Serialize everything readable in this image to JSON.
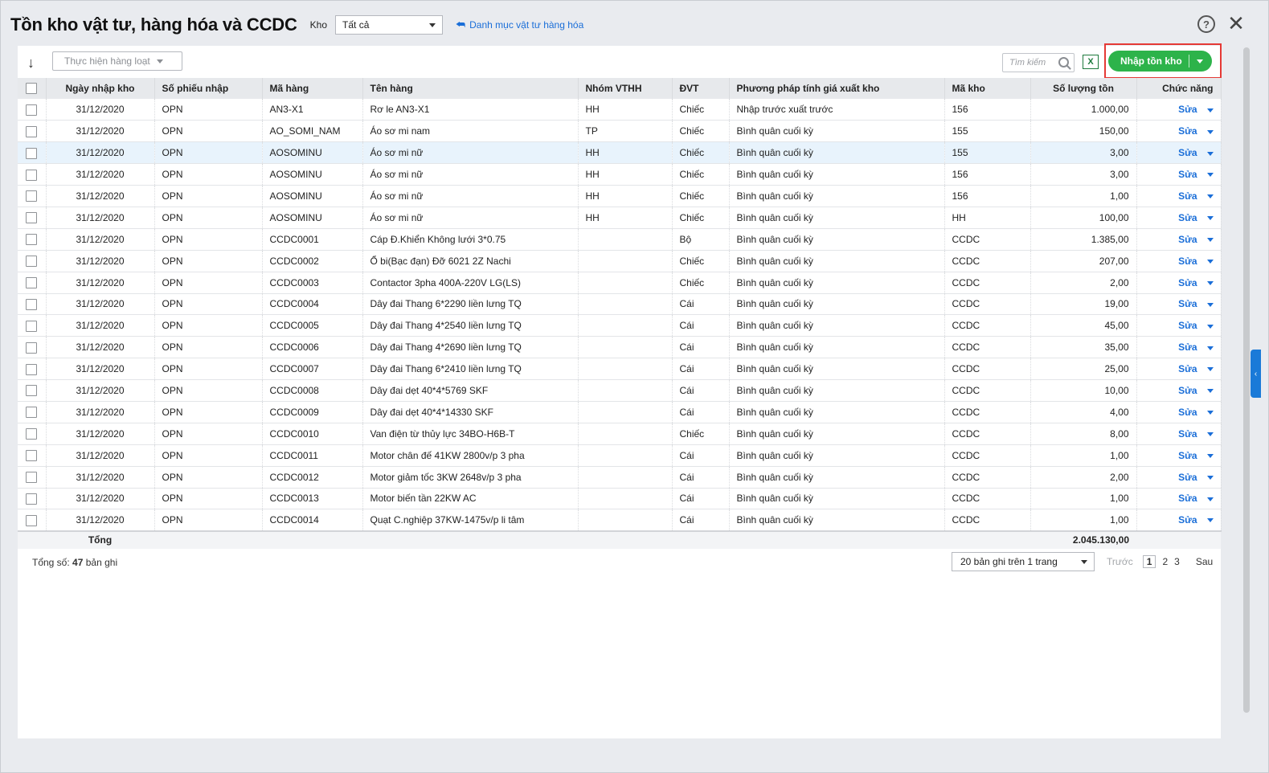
{
  "header": {
    "title": "Tồn kho vật tư, hàng hóa và CCDC",
    "kho_label": "Kho",
    "kho_value": "Tất cả",
    "catalog_link": "Danh mục vật tư hàng hóa",
    "help": "?",
    "close": "✕"
  },
  "toolbar": {
    "bulk_action": "Thực hiện hàng loạt",
    "search_placeholder": "Tìm kiếm",
    "excel": "X",
    "import_button": "Nhập tồn kho"
  },
  "columns": [
    "Ngày nhập kho",
    "Số phiếu nhập",
    "Mã hàng",
    "Tên hàng",
    "Nhóm VTHH",
    "ĐVT",
    "Phương pháp tính giá xuất kho",
    "Mã kho",
    "Số lượng tồn",
    "Chức năng"
  ],
  "rows": [
    {
      "date": "31/12/2020",
      "doc": "OPN",
      "code": "AN3-X1",
      "name": "Rơ le AN3-X1",
      "group": "HH",
      "unit": "Chiếc",
      "method": "Nhập trước xuất trước",
      "wh": "156",
      "qty": "1.000,00",
      "action": "Sửa"
    },
    {
      "date": "31/12/2020",
      "doc": "OPN",
      "code": "AO_SOMI_NAM",
      "name": "Áo sơ mi nam",
      "group": "TP",
      "unit": "Chiếc",
      "method": "Bình quân cuối kỳ",
      "wh": "155",
      "qty": "150,00",
      "action": "Sửa"
    },
    {
      "date": "31/12/2020",
      "doc": "OPN",
      "code": "AOSOMINU",
      "name": "Áo sơ mi nữ",
      "group": "HH",
      "unit": "Chiếc",
      "method": "Bình quân cuối kỳ",
      "wh": "155",
      "qty": "3,00",
      "action": "Sửa",
      "selected": true
    },
    {
      "date": "31/12/2020",
      "doc": "OPN",
      "code": "AOSOMINU",
      "name": "Áo sơ mi nữ",
      "group": "HH",
      "unit": "Chiếc",
      "method": "Bình quân cuối kỳ",
      "wh": "156",
      "qty": "3,00",
      "action": "Sửa"
    },
    {
      "date": "31/12/2020",
      "doc": "OPN",
      "code": "AOSOMINU",
      "name": "Áo sơ mi nữ",
      "group": "HH",
      "unit": "Chiếc",
      "method": "Bình quân cuối kỳ",
      "wh": "156",
      "qty": "1,00",
      "action": "Sửa"
    },
    {
      "date": "31/12/2020",
      "doc": "OPN",
      "code": "AOSOMINU",
      "name": "Áo sơ mi nữ",
      "group": "HH",
      "unit": "Chiếc",
      "method": "Bình quân cuối kỳ",
      "wh": "HH",
      "qty": "100,00",
      "action": "Sửa"
    },
    {
      "date": "31/12/2020",
      "doc": "OPN",
      "code": "CCDC0001",
      "name": "Cáp Đ.Khiển Không lưới 3*0.75",
      "group": "",
      "unit": "Bộ",
      "method": "Bình quân cuối kỳ",
      "wh": "CCDC",
      "qty": "1.385,00",
      "action": "Sửa"
    },
    {
      "date": "31/12/2020",
      "doc": "OPN",
      "code": "CCDC0002",
      "name": "Ổ bi(Bạc đạn) Đỡ 6021 2Z Nachi",
      "group": "",
      "unit": "Chiếc",
      "method": "Bình quân cuối kỳ",
      "wh": "CCDC",
      "qty": "207,00",
      "action": "Sửa"
    },
    {
      "date": "31/12/2020",
      "doc": "OPN",
      "code": "CCDC0003",
      "name": "Contactor 3pha 400A-220V LG(LS)",
      "group": "",
      "unit": "Chiếc",
      "method": "Bình quân cuối kỳ",
      "wh": "CCDC",
      "qty": "2,00",
      "action": "Sửa"
    },
    {
      "date": "31/12/2020",
      "doc": "OPN",
      "code": "CCDC0004",
      "name": "Dây đai Thang 6*2290 liền lưng TQ",
      "group": "",
      "unit": "Cái",
      "method": "Bình quân cuối kỳ",
      "wh": "CCDC",
      "qty": "19,00",
      "action": "Sửa"
    },
    {
      "date": "31/12/2020",
      "doc": "OPN",
      "code": "CCDC0005",
      "name": "Dây đai Thang 4*2540 liền lưng TQ",
      "group": "",
      "unit": "Cái",
      "method": "Bình quân cuối kỳ",
      "wh": "CCDC",
      "qty": "45,00",
      "action": "Sửa"
    },
    {
      "date": "31/12/2020",
      "doc": "OPN",
      "code": "CCDC0006",
      "name": "Dây đai Thang 4*2690 liền lưng TQ",
      "group": "",
      "unit": "Cái",
      "method": "Bình quân cuối kỳ",
      "wh": "CCDC",
      "qty": "35,00",
      "action": "Sửa"
    },
    {
      "date": "31/12/2020",
      "doc": "OPN",
      "code": "CCDC0007",
      "name": "Dây đai Thang 6*2410 liền lưng TQ",
      "group": "",
      "unit": "Cái",
      "method": "Bình quân cuối kỳ",
      "wh": "CCDC",
      "qty": "25,00",
      "action": "Sửa"
    },
    {
      "date": "31/12/2020",
      "doc": "OPN",
      "code": "CCDC0008",
      "name": "Dây đai dẹt 40*4*5769 SKF",
      "group": "",
      "unit": "Cái",
      "method": "Bình quân cuối kỳ",
      "wh": "CCDC",
      "qty": "10,00",
      "action": "Sửa"
    },
    {
      "date": "31/12/2020",
      "doc": "OPN",
      "code": "CCDC0009",
      "name": "Dây đai dẹt 40*4*14330 SKF",
      "group": "",
      "unit": "Cái",
      "method": "Bình quân cuối kỳ",
      "wh": "CCDC",
      "qty": "4,00",
      "action": "Sửa"
    },
    {
      "date": "31/12/2020",
      "doc": "OPN",
      "code": "CCDC0010",
      "name": "Van điện từ thủy lực 34BO-H6B-T",
      "group": "",
      "unit": "Chiếc",
      "method": "Bình quân cuối kỳ",
      "wh": "CCDC",
      "qty": "8,00",
      "action": "Sửa"
    },
    {
      "date": "31/12/2020",
      "doc": "OPN",
      "code": "CCDC0011",
      "name": "Motor chân đế 41KW 2800v/p 3 pha",
      "group": "",
      "unit": "Cái",
      "method": "Bình quân cuối kỳ",
      "wh": "CCDC",
      "qty": "1,00",
      "action": "Sửa"
    },
    {
      "date": "31/12/2020",
      "doc": "OPN",
      "code": "CCDC0012",
      "name": "Motor giảm tốc 3KW 2648v/p 3 pha",
      "group": "",
      "unit": "Cái",
      "method": "Bình quân cuối kỳ",
      "wh": "CCDC",
      "qty": "2,00",
      "action": "Sửa"
    },
    {
      "date": "31/12/2020",
      "doc": "OPN",
      "code": "CCDC0013",
      "name": "Motor biến tần 22KW AC",
      "group": "",
      "unit": "Cái",
      "method": "Bình quân cuối kỳ",
      "wh": "CCDC",
      "qty": "1,00",
      "action": "Sửa"
    },
    {
      "date": "31/12/2020",
      "doc": "OPN",
      "code": "CCDC0014",
      "name": "Quạt C.nghiệp 37KW-1475v/p li tâm",
      "group": "",
      "unit": "Cái",
      "method": "Bình quân cuối kỳ",
      "wh": "CCDC",
      "qty": "1,00",
      "action": "Sửa"
    }
  ],
  "total": {
    "label": "Tổng",
    "qty": "2.045.130,00"
  },
  "footer": {
    "count_prefix": "Tổng số:",
    "count": "47",
    "count_suffix": "bản ghi",
    "page_size": "20 bản ghi trên 1 trang",
    "prev": "Trước",
    "pages": [
      "1",
      "2",
      "3"
    ],
    "current_page": "1",
    "next": "Sau"
  },
  "colors": {
    "accent": "#1a6ed8",
    "primary_button": "#2db34a",
    "highlight": "#e53935"
  }
}
